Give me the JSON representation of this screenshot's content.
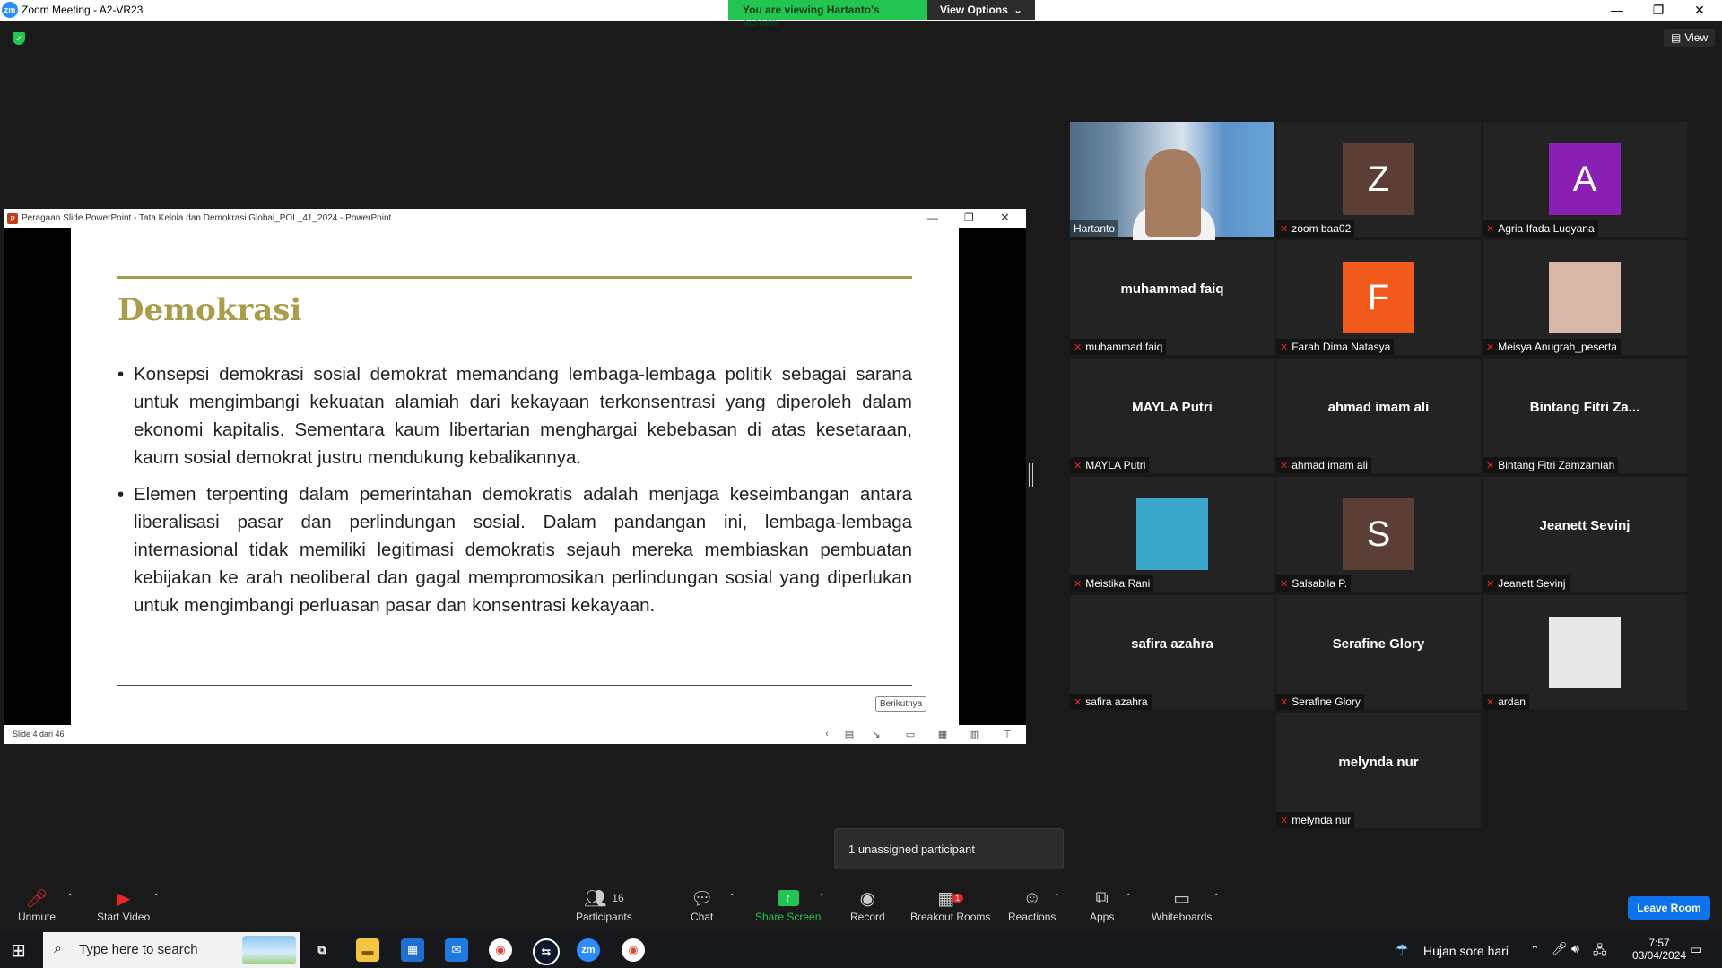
{
  "window": {
    "title": "Zoom Meeting - A2-VR23",
    "app_icon": "zm"
  },
  "share_banner": {
    "viewing_text": "You are viewing Hartanto's screen",
    "options_label": "View Options"
  },
  "top_right_view_label": "View",
  "powerpoint": {
    "window_title": "Peragaan Slide PowerPoint  -  Tata Kelola dan Demokrasi Global_POL_41_2024  -  PowerPoint",
    "slide_title": "Demokrasi",
    "bullets": [
      "Konsepsi demokrasi sosial demokrat memandang lembaga-lembaga politik sebagai sarana untuk mengimbangi kekuatan alamiah dari kekayaan terkonsentrasi yang diperoleh dalam ekonomi kapitalis. Sementara kaum libertarian menghargai kebebasan di atas kesetaraan, kaum sosial demokrat justru mendukung kebalikannya.",
      "Elemen terpenting dalam pemerintahan demokratis adalah menjaga keseimbangan antara liberalisasi pasar dan perlindungan sosial. Dalam pandangan ini, lembaga-lembaga internasional tidak memiliki legitimasi demokratis sejauh mereka membiaskan pembuatan kebijakan ke arah neoliberal dan gagal mempromosikan perlindungan sosial yang diperlukan untuk mengimbangi perluasan pasar dan konsentrasi kekayaan."
    ],
    "next_label": "Berikutnya",
    "status": "Slide 4 dari 46"
  },
  "participants": [
    {
      "label": "Hartanto",
      "type": "video",
      "active": true
    },
    {
      "label": "zoom baa02",
      "type": "avatar",
      "letter": "Z",
      "color": "#5b3e36"
    },
    {
      "label": "Agria Ifada Luqyana",
      "type": "avatar",
      "letter": "A",
      "color": "#8a1fb3"
    },
    {
      "label": "muhammad faiq",
      "type": "name",
      "display": "muhammad faiq"
    },
    {
      "label": "Farah Dima Natasya",
      "type": "avatar",
      "letter": "F",
      "color": "#f25a1d"
    },
    {
      "label": "Meisya Anugrah_peserta",
      "type": "photo",
      "color": "#d9b7a8"
    },
    {
      "label": "MAYLA Putri",
      "type": "name",
      "display": "MAYLA Putri"
    },
    {
      "label": "ahmad imam ali",
      "type": "name",
      "display": "ahmad imam ali"
    },
    {
      "label": "Bintang Fitri Zamzamiah",
      "type": "name",
      "display": "Bintang Fitri Za..."
    },
    {
      "label": "Meistika Rani",
      "type": "photo",
      "color": "#3aa6c9"
    },
    {
      "label": "Salsabila P.",
      "type": "avatar",
      "letter": "S",
      "color": "#5b3e36"
    },
    {
      "label": "Jeanett Sevinj",
      "type": "name",
      "display": "Jeanett Sevinj"
    },
    {
      "label": "safira azahra",
      "type": "name",
      "display": "safira azahra"
    },
    {
      "label": "Serafine Glory",
      "type": "name",
      "display": "Serafine Glory"
    },
    {
      "label": "ardan",
      "type": "photo",
      "color": "#e8e8e8"
    },
    {
      "label": "melynda nur",
      "type": "name",
      "display": "melynda nur"
    }
  ],
  "tooltip": "1 unassigned participant",
  "toolbar": {
    "unmute": "Unmute",
    "start_video": "Start Video",
    "participants": "Participants",
    "participants_count": "16",
    "chat": "Chat",
    "share_screen": "Share Screen",
    "record": "Record",
    "breakout_rooms": "Breakout Rooms",
    "breakout_badge": "1",
    "reactions": "Reactions",
    "apps": "Apps",
    "whiteboards": "Whiteboards",
    "leave": "Leave Room"
  },
  "taskbar": {
    "search_placeholder": "Type here to search",
    "weather": "Hujan sore hari",
    "time": "7:57",
    "date": "03/04/2024"
  }
}
